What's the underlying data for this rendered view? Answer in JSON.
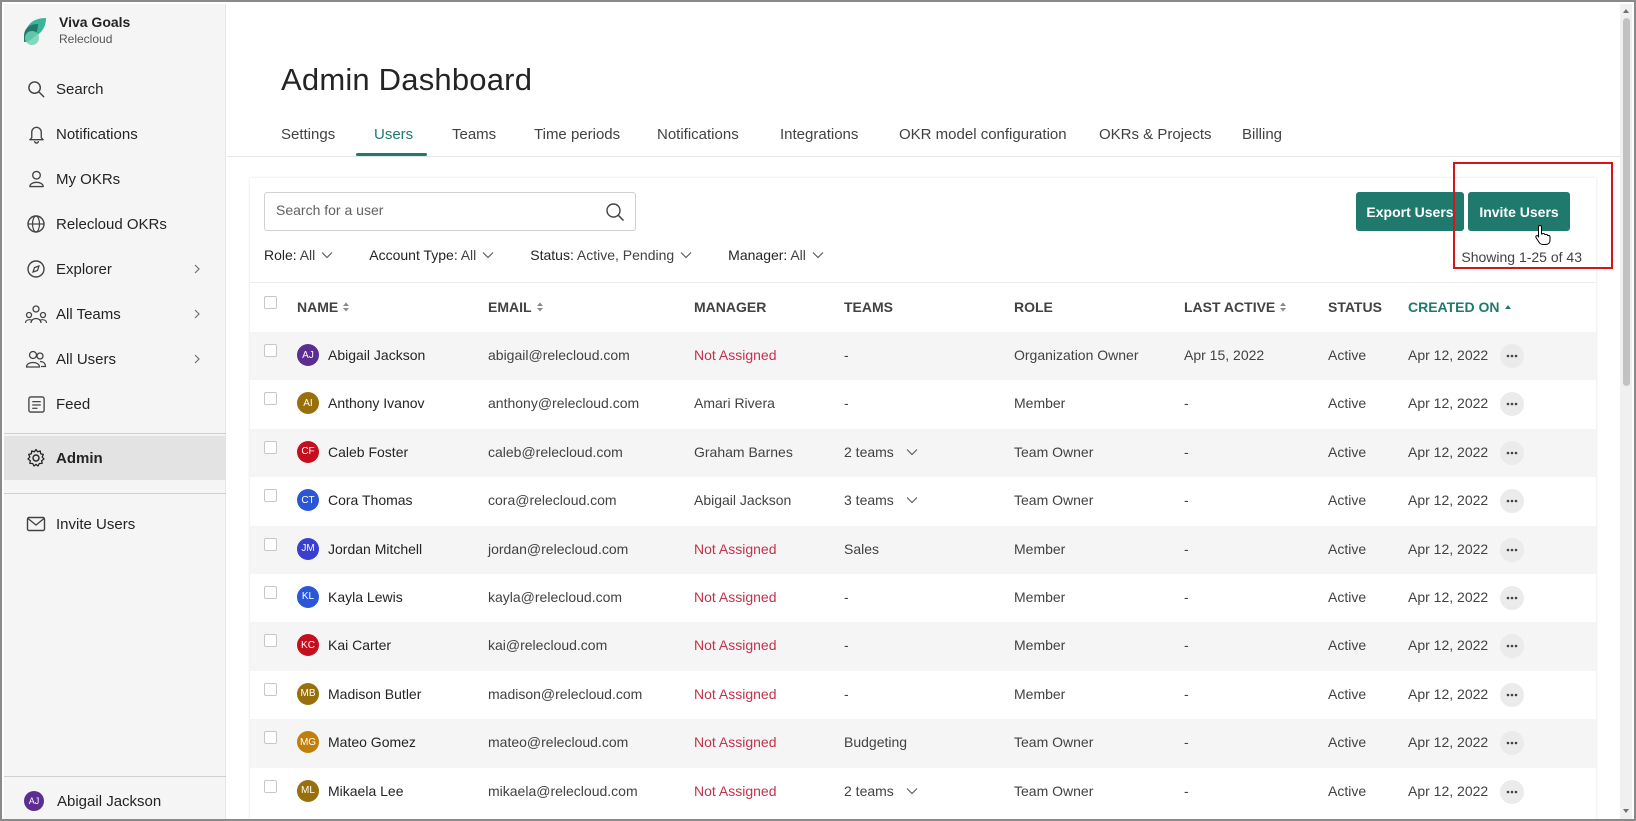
{
  "brand": {
    "name": "Viva Goals",
    "org": "Relecloud"
  },
  "sidebar": {
    "items": [
      {
        "label": "Search",
        "icon": "search-icon"
      },
      {
        "label": "Notifications",
        "icon": "bell-icon"
      },
      {
        "label": "My OKRs",
        "icon": "person-icon"
      },
      {
        "label": "Relecloud OKRs",
        "icon": "globe-icon"
      },
      {
        "label": "Explorer",
        "icon": "compass-icon",
        "chevron": true
      },
      {
        "label": "All Teams",
        "icon": "teams-icon",
        "chevron": true
      },
      {
        "label": "All Users",
        "icon": "users-icon",
        "chevron": true
      },
      {
        "label": "Feed",
        "icon": "feed-icon"
      },
      {
        "label": "Admin",
        "icon": "gear-icon",
        "active": true
      },
      {
        "label": "Invite Users",
        "icon": "mail-icon"
      }
    ],
    "user": {
      "initials": "AJ",
      "name": "Abigail Jackson"
    }
  },
  "page": {
    "title": "Admin Dashboard"
  },
  "tabs": [
    "Settings",
    "Users",
    "Teams",
    "Time periods",
    "Notifications",
    "Integrations",
    "OKR model configuration",
    "OKRs & Projects",
    "Billing"
  ],
  "active_tab": "Users",
  "search": {
    "placeholder": "Search for a user",
    "value": ""
  },
  "filters": [
    {
      "label": "Role:",
      "value": "All"
    },
    {
      "label": "Account Type:",
      "value": "All"
    },
    {
      "label": "Status:",
      "value": "Active, Pending"
    },
    {
      "label": "Manager:",
      "value": "All"
    }
  ],
  "buttons": {
    "export": "Export Users",
    "invite": "Invite Users"
  },
  "showing": "Showing 1-25 of 43",
  "table": {
    "columns": [
      {
        "label": "NAME",
        "sortable": true
      },
      {
        "label": "EMAIL",
        "sortable": true
      },
      {
        "label": "MANAGER",
        "sortable": false
      },
      {
        "label": "TEAMS",
        "sortable": false
      },
      {
        "label": "ROLE",
        "sortable": false
      },
      {
        "label": "LAST ACTIVE",
        "sortable": true
      },
      {
        "label": "STATUS",
        "sortable": false
      },
      {
        "label": "CREATED ON",
        "sortable": true,
        "sorted": "asc"
      }
    ],
    "rows": [
      {
        "initials": "AJ",
        "color": "#5c2e91",
        "name": "Abigail Jackson",
        "email": "abigail@relecloud.com",
        "manager": "Not Assigned",
        "teams": "-",
        "teams_dropdown": false,
        "role": "Organization Owner",
        "last_active": "Apr 15, 2022",
        "status": "Active",
        "created": "Apr 12, 2022"
      },
      {
        "initials": "AI",
        "color": "#986f0b",
        "name": "Anthony Ivanov",
        "email": "anthony@relecloud.com",
        "manager": "Amari Rivera",
        "teams": "-",
        "teams_dropdown": false,
        "role": "Member",
        "last_active": "-",
        "status": "Active",
        "created": "Apr 12, 2022"
      },
      {
        "initials": "CF",
        "color": "#c50f1f",
        "name": "Caleb Foster",
        "email": "caleb@relecloud.com",
        "manager": "Graham Barnes",
        "teams": "2 teams",
        "teams_dropdown": true,
        "role": "Team Owner",
        "last_active": "-",
        "status": "Active",
        "created": "Apr 12, 2022"
      },
      {
        "initials": "CT",
        "color": "#2b57d6",
        "name": "Cora Thomas",
        "email": "cora@relecloud.com",
        "manager": "Abigail Jackson",
        "teams": "3 teams",
        "teams_dropdown": true,
        "role": "Team Owner",
        "last_active": "-",
        "status": "Active",
        "created": "Apr 12, 2022"
      },
      {
        "initials": "JM",
        "color": "#3a3fd0",
        "name": "Jordan Mitchell",
        "email": "jordan@relecloud.com",
        "manager": "Not Assigned",
        "teams": "Sales",
        "teams_dropdown": false,
        "role": "Member",
        "last_active": "-",
        "status": "Active",
        "created": "Apr 12, 2022"
      },
      {
        "initials": "KL",
        "color": "#2b57d6",
        "name": "Kayla Lewis",
        "email": "kayla@relecloud.com",
        "manager": "Not Assigned",
        "teams": "-",
        "teams_dropdown": false,
        "role": "Member",
        "last_active": "-",
        "status": "Active",
        "created": "Apr 12, 2022"
      },
      {
        "initials": "KC",
        "color": "#c50f1f",
        "name": "Kai Carter",
        "email": "kai@relecloud.com",
        "manager": "Not Assigned",
        "teams": "-",
        "teams_dropdown": false,
        "role": "Member",
        "last_active": "-",
        "status": "Active",
        "created": "Apr 12, 2022"
      },
      {
        "initials": "MB",
        "color": "#986f0b",
        "name": "Madison Butler",
        "email": "madison@relecloud.com",
        "manager": "Not Assigned",
        "teams": "-",
        "teams_dropdown": false,
        "role": "Member",
        "last_active": "-",
        "status": "Active",
        "created": "Apr 12, 2022"
      },
      {
        "initials": "MG",
        "color": "#c17e0a",
        "name": "Mateo Gomez",
        "email": "mateo@relecloud.com",
        "manager": "Not Assigned",
        "teams": "Budgeting",
        "teams_dropdown": false,
        "role": "Team Owner",
        "last_active": "-",
        "status": "Active",
        "created": "Apr 12, 2022"
      },
      {
        "initials": "ML",
        "color": "#986f0b",
        "name": "Mikaela Lee",
        "email": "mikaela@relecloud.com",
        "manager": "Not Assigned",
        "teams": "2 teams",
        "teams_dropdown": true,
        "role": "Team Owner",
        "last_active": "-",
        "status": "Active",
        "created": "Apr 12, 2022"
      }
    ]
  },
  "colors": {
    "accent": "#1f7a6d",
    "unassigned": "#c4314b",
    "highlight": "#d7141a"
  }
}
